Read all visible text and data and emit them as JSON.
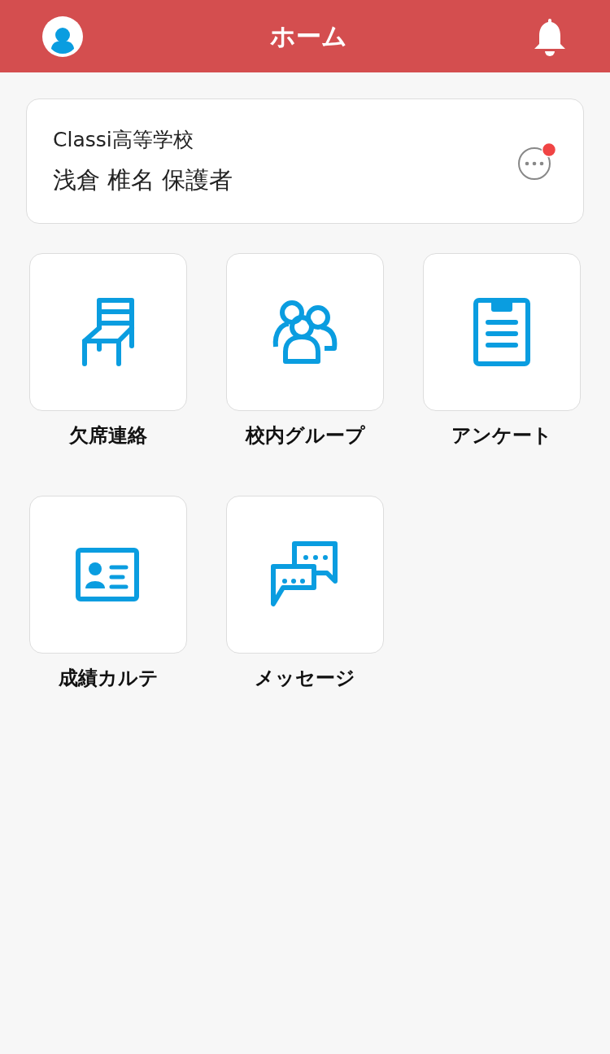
{
  "header": {
    "title": "ホーム"
  },
  "profile_card": {
    "school": "Classi高等学校",
    "user": "浅倉 椎名 保護者",
    "unread": true
  },
  "menu": [
    {
      "kind": "chair",
      "label": "欠席連絡"
    },
    {
      "kind": "group",
      "label": "校内グループ"
    },
    {
      "kind": "clipboard",
      "label": "アンケート"
    },
    {
      "kind": "idcard",
      "label": "成績カルテ"
    },
    {
      "kind": "chat",
      "label": "メッセージ"
    }
  ]
}
